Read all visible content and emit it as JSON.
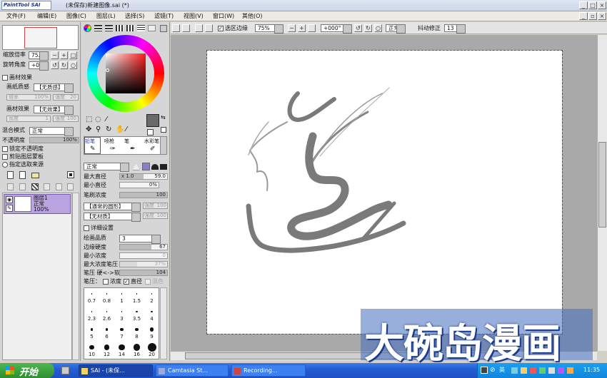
{
  "titlebar": {
    "logo": "PaintTool SAI",
    "title": "(未保存)新建图像.sai (*)"
  },
  "menu": [
    "文件(F)",
    "编辑(E)",
    "图像(C)",
    "图层(L)",
    "选择(S)",
    "滤镜(T)",
    "视图(V)",
    "窗口(W)",
    "其他(O)"
  ],
  "nav": {
    "zoom_label": "缩放倍率",
    "zoom_value": "75.0%",
    "rotate_label": "旋转角度",
    "rotate_value": "+000"
  },
  "paper": {
    "header": "画材效果",
    "texture_label": "画纸质感",
    "texture_value": "【无质感】",
    "scale_label": "倍率",
    "scale_value": "100%",
    "strength_label": "强度",
    "strength_value": "20",
    "effect_label": "画材效果",
    "effect_value": "【无效果】",
    "width_label": "宽度",
    "width_value": "1",
    "str2_label": "强度",
    "str2_value": "100"
  },
  "layer_panel": {
    "blend_label": "混合模式",
    "blend_value": "正常",
    "opacity_label": "不透明度",
    "opacity_value": "100%",
    "opacity_level": 1.0,
    "protect": "锁定不透明度",
    "clip": "剪贴图层蒙板",
    "selsrc": "指定选取来源"
  },
  "layer": {
    "name": "图层1",
    "mode": "正常",
    "opacity": "100%"
  },
  "colors": {
    "primary": "#6a6a6a",
    "accent": "#b9a3e0",
    "titlebar": "#1f5bd8"
  },
  "toolbar": {
    "stabilizer_check": "选区边缘",
    "zoom": "75%",
    "angle": "+000°",
    "blend": "正常",
    "stab_label": "抖动修正",
    "stab_value": "13"
  },
  "tools": [
    "铅笔",
    "喷枪",
    "笔",
    "水彩笔"
  ],
  "brush": {
    "mode": "正常",
    "max_label": "最大直径",
    "max_mult": "x 1.0",
    "max_value": "59.0",
    "max_level": 0.5,
    "min_label": "最小直径",
    "min_value": "0%",
    "density_label": "笔刷浓度",
    "density_value": "100",
    "density_level": 1.0,
    "shape": "【通常的圆形】",
    "shape_str": "强度",
    "shape_val": "100",
    "tex": "【无材质】",
    "tex_str": "强度",
    "tex_val": "100"
  },
  "details": {
    "header": "详细设置",
    "quality_label": "绘画品质",
    "quality_value": "3",
    "edge_label": "边缘硬度",
    "edge_value": "67",
    "edge_level": 0.67,
    "mindens_label": "最小浓度",
    "mindens_value": "0",
    "maxpress_label": "最大浓度笔压",
    "maxpress_value": "37%",
    "maxpress_level": 0.37,
    "press_label": "笔压 硬<->软",
    "press_value": "104",
    "press_level": 1.0,
    "pen_label": "笔压：",
    "pen_density": "浓度",
    "pen_diam": "直径",
    "pen_blend": "混色"
  },
  "sizes": [
    "0.7",
    "0.8",
    "1",
    "1.5",
    "2",
    "2.3",
    "2.6",
    "3",
    "3.5",
    "4",
    "5",
    "6",
    "7",
    "8",
    "9",
    "10",
    "12",
    "14",
    "16",
    "20"
  ],
  "watermark": "大碗岛漫画",
  "taskbar": {
    "start": "开始",
    "items": [
      "SAI - (未保...",
      "Camtasia St...",
      "Recording..."
    ],
    "ime": "英",
    "clock": "11:35"
  }
}
